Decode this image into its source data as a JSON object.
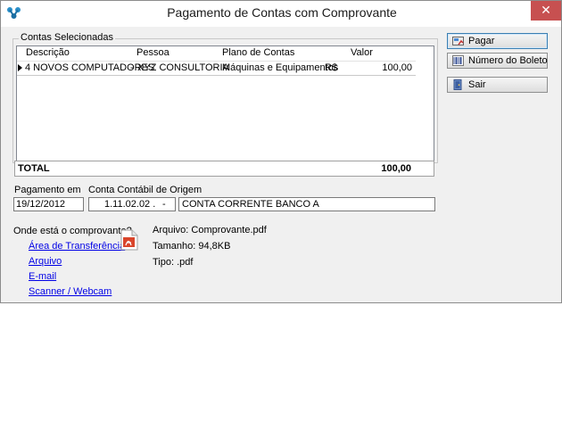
{
  "window": {
    "title": "Pagamento de Contas com Comprovante",
    "close_glyph": "✕"
  },
  "group": {
    "title": "Contas Selecionadas",
    "columns": [
      "Descrição",
      "Pessoa",
      "Plano de Contas",
      "Valor"
    ],
    "rows": [
      {
        "descricao": "4 NOVOS COMPUTADORES",
        "pessoa": "XYZ CONSULTORIA",
        "plano": "Máquinas e Equipamentos",
        "moeda": "R$",
        "valor": "100,00"
      }
    ],
    "row_separator": "-"
  },
  "total": {
    "label": "TOTAL",
    "value": "100,00"
  },
  "pagamento": {
    "label": "Pagamento em",
    "value": "19/12/2012"
  },
  "conta": {
    "label": "Conta Contábil de Origem",
    "code": "1.11.02.02 .",
    "dash": "-",
    "name": "CONTA CORRENTE BANCO A"
  },
  "comprovante": {
    "question": "Onde está o comprovante?",
    "options": [
      "Área de Transferência",
      "Arquivo",
      "E-mail",
      "Scanner / Webcam"
    ],
    "arquivo": "Arquivo: Comprovante.pdf",
    "tamanho": "Tamanho: 94,8KB",
    "tipo": "Tipo: .pdf"
  },
  "buttons": {
    "pagar": "Pagar",
    "boleto": "Número do Boleto",
    "sair": "Sair"
  },
  "icons": {
    "app": "app-logo-icon",
    "pagar": "pay-icon",
    "boleto": "barcode-icon",
    "sair": "exit-door-icon",
    "file": "pdf-file-icon"
  },
  "colors": {
    "link": "#0000e6",
    "close": "#c75050",
    "pdf": "#d9452b"
  }
}
